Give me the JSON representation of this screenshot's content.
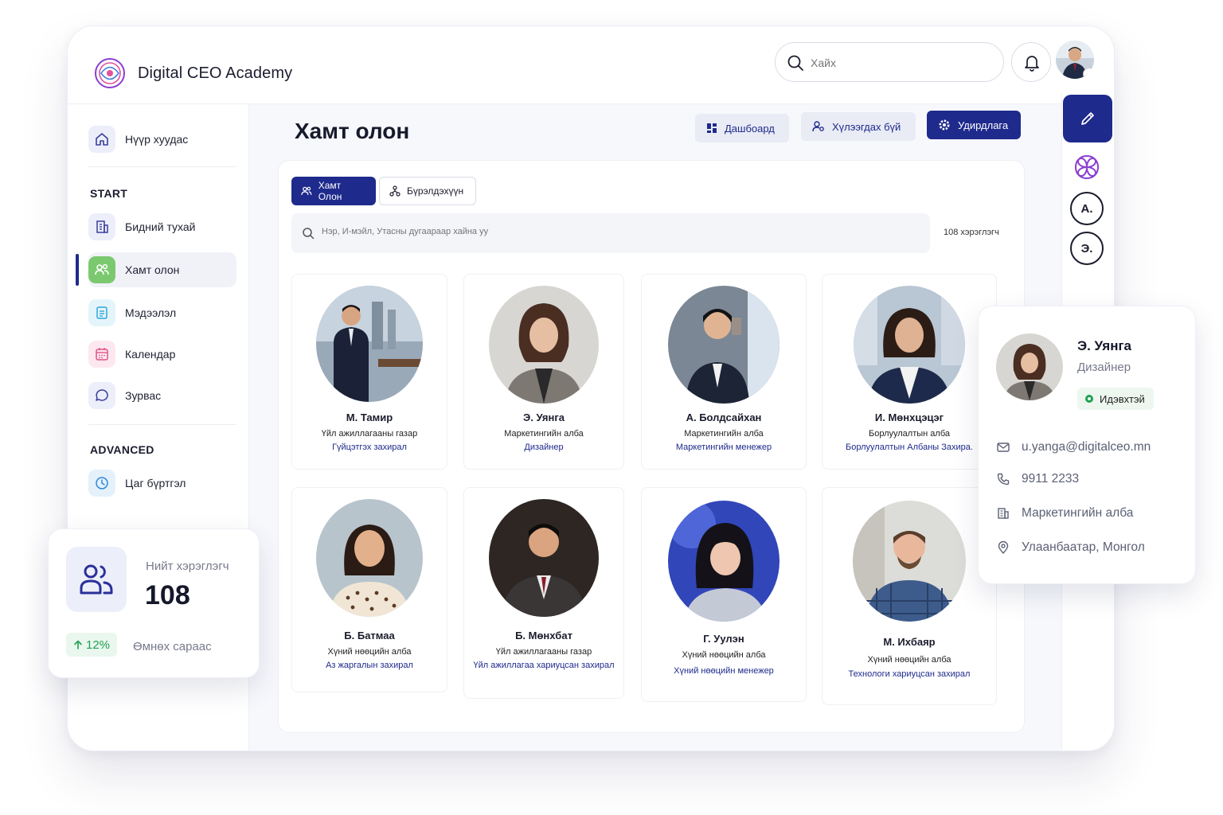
{
  "app": {
    "brand": "Digital CEO Academy"
  },
  "search": {
    "placeholder": "Хайх"
  },
  "sidebar": {
    "home": "Нүүр хуудас",
    "section_start": "START",
    "items": [
      {
        "label": "Бидний тухай"
      },
      {
        "label": "Хамт олон"
      },
      {
        "label": "Мэдээлэл"
      },
      {
        "label": "Календар"
      },
      {
        "label": "Зурвас"
      }
    ],
    "section_advanced": "ADVANCED",
    "advanced_items": [
      {
        "label": "Цаг бүртгэл"
      }
    ]
  },
  "page": {
    "title": "Хамт олон",
    "buttons": {
      "dashboard": "Дашбоард",
      "manager": "Хүлээгдах бүй",
      "admin": "Удирдлага"
    },
    "tabs": {
      "team": "Хамт Олон",
      "structure": "Бүрэлдэхүүн"
    },
    "filter_placeholder": "Нэр, И-мэйл, Утасны дугаараар хайна уу",
    "user_count": "108 хэрэглэгч"
  },
  "members": [
    {
      "name": "М. Тамир",
      "dept": "Үйл ажиллагааны газар",
      "role": "Гүйцэтгэх захирал"
    },
    {
      "name": "Э. Уянга",
      "dept": "Маркетингийн алба",
      "role": "Дизайнер"
    },
    {
      "name": "А. Болдсайхан",
      "dept": "Маркетингийн алба",
      "role": "Маркетингийн менежер"
    },
    {
      "name": "И. Мөнхцэцэг",
      "dept": "Борлуулалтын алба",
      "role": "Борлуулалтын Албаны Захира."
    },
    {
      "name": "Б. Батмаа",
      "dept": "Хүний нөөцийн алба",
      "role": "Аз жаргалын захирал"
    },
    {
      "name": "Б. Мөнхбат",
      "dept": "Үйл ажиллагааны газар",
      "role": "Үйл ажиллагаа хариуцсан захирал"
    },
    {
      "name": "Г. Уулэн",
      "dept": "Хүний нөөцийн алба",
      "role": "Хүний нөөцийн менежер"
    },
    {
      "name": "М. Ихбаяр",
      "dept": "Хүний нөөцийн алба",
      "role": "Технологи хариуцсан захирал"
    }
  ],
  "rail": {
    "avatars": [
      "А.",
      "Э."
    ]
  },
  "stat_card": {
    "label": "Нийт хэрэглэгч",
    "value": "108",
    "change": "12%",
    "subtitle": "Өмнөх сараас"
  },
  "profile_card": {
    "name": "Э. Уянга",
    "role": "Дизайнер",
    "status": "Идэвхтэй",
    "email": "u.yanga@digitalceo.mn",
    "phone": "9911 2233",
    "department": "Маркетингийн алба",
    "location": "Улаанбаатар, Монгол"
  },
  "colors": {
    "primary": "#1e2a8c",
    "success": "#22a052",
    "accent_purple": "#8a3fd1"
  }
}
